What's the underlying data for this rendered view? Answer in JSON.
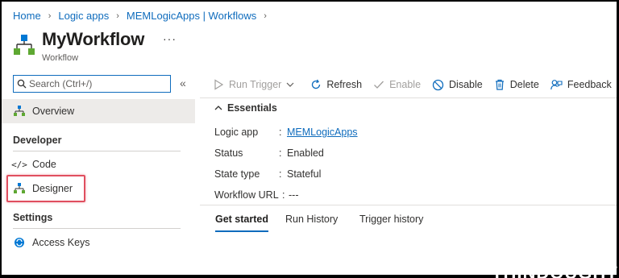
{
  "breadcrumb": [
    "Home",
    "Logic apps",
    "MEMLogicApps | Workflows"
  ],
  "page": {
    "title": "MyWorkflow",
    "subtitle": "Workflow",
    "more": "···"
  },
  "search": {
    "placeholder": "Search (Ctrl+/)",
    "collapse": "«"
  },
  "sidebar": {
    "overview": "Overview",
    "developer_header": "Developer",
    "code": "Code",
    "designer": "Designer",
    "settings_header": "Settings",
    "access_keys": "Access Keys"
  },
  "toolbar": {
    "run_trigger": "Run Trigger",
    "refresh": "Refresh",
    "enable": "Enable",
    "disable": "Disable",
    "delete": "Delete",
    "feedback": "Feedback"
  },
  "essentials": {
    "label": "Essentials",
    "rows": [
      {
        "label": "Logic app",
        "value": "MEMLogicApps"
      },
      {
        "label": "Status",
        "value": "Enabled"
      },
      {
        "label": "State type",
        "value": "Stateful"
      },
      {
        "label": "Workflow URL",
        "value": "---"
      }
    ]
  },
  "tabs": [
    "Get started",
    "Run History",
    "Trigger history"
  ],
  "watermark": "THINDOUGHT",
  "colors": {
    "accent": "#0f6cbd",
    "highlight": "#e04f5f",
    "selected_bg": "#edebe9"
  }
}
